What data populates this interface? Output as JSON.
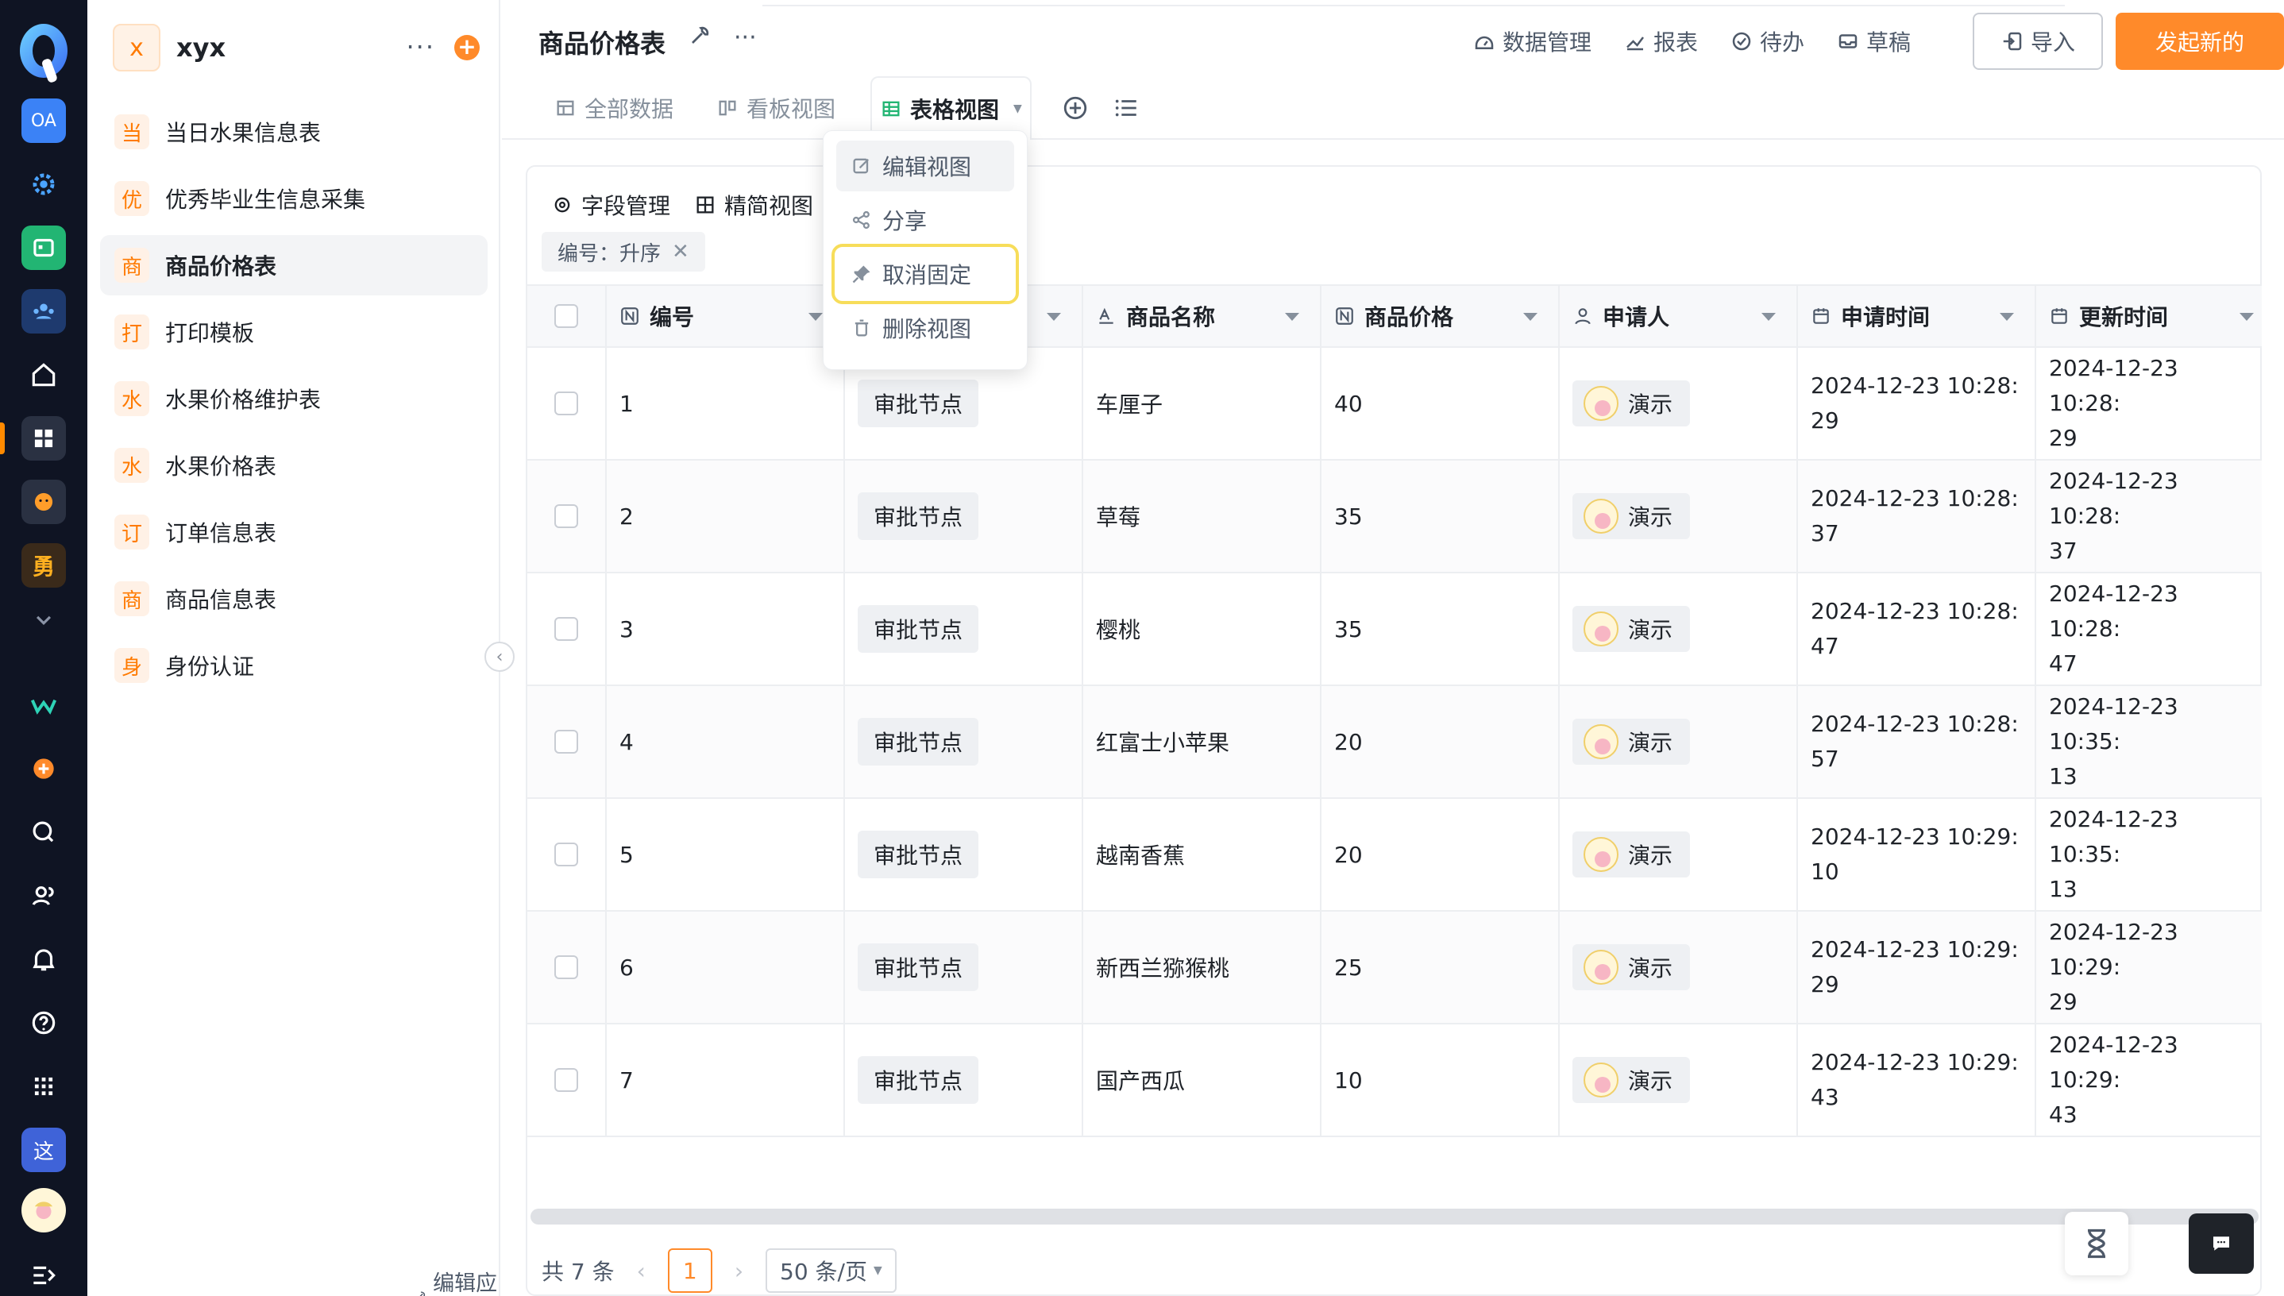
{
  "app": {
    "avatar_letter": "x",
    "name": "xyx",
    "edit_package": "编辑应用包"
  },
  "rail_colors": {
    "accent": "#ff8a00",
    "bg": "#0f1423"
  },
  "rail": {
    "oa_label": "OA",
    "yong_label": "勇",
    "zhe_label": "这"
  },
  "menu": [
    {
      "badge": "当",
      "label": "当日水果信息表"
    },
    {
      "badge": "优",
      "label": "优秀毕业生信息采集"
    },
    {
      "badge": "商",
      "label": "商品价格表"
    },
    {
      "badge": "打",
      "label": "打印模板"
    },
    {
      "badge": "水",
      "label": "水果价格维护表"
    },
    {
      "badge": "水",
      "label": "水果价格表"
    },
    {
      "badge": "订",
      "label": "订单信息表"
    },
    {
      "badge": "商",
      "label": "商品信息表"
    },
    {
      "badge": "身",
      "label": "身份认证"
    }
  ],
  "header": {
    "title": "商品价格表",
    "links": [
      "数据管理",
      "报表",
      "待办",
      "草稿"
    ],
    "import_label": "导入",
    "new_label": "发起新的"
  },
  "tabs": [
    "全部数据",
    "看板视图",
    "表格视图"
  ],
  "toolbar": {
    "fields": "字段管理",
    "simple_view": "精简视图"
  },
  "sort_chip": "编号：升序",
  "dropdown": [
    "编辑视图",
    "分享",
    "取消固定",
    "删除视图"
  ],
  "columns": [
    "编号",
    "",
    "商品名称",
    "商品价格",
    "申请人",
    "申请时间",
    "更新时间"
  ],
  "rows": [
    {
      "id": "1",
      "node": "审批节点",
      "name": "车厘子",
      "price": "40",
      "user": "演示",
      "apply": "2024-12-23 10:28:\n29",
      "update": "2024-12-23 10:28:\n29"
    },
    {
      "id": "2",
      "node": "审批节点",
      "name": "草莓",
      "price": "35",
      "user": "演示",
      "apply": "2024-12-23 10:28:\n37",
      "update": "2024-12-23 10:28:\n37"
    },
    {
      "id": "3",
      "node": "审批节点",
      "name": "樱桃",
      "price": "35",
      "user": "演示",
      "apply": "2024-12-23 10:28:\n47",
      "update": "2024-12-23 10:28:\n47"
    },
    {
      "id": "4",
      "node": "审批节点",
      "name": "红富士小苹果",
      "price": "20",
      "user": "演示",
      "apply": "2024-12-23 10:28:\n57",
      "update": "2024-12-23 10:35:\n13"
    },
    {
      "id": "5",
      "node": "审批节点",
      "name": "越南香蕉",
      "price": "20",
      "user": "演示",
      "apply": "2024-12-23 10:29:\n10",
      "update": "2024-12-23 10:35:\n13"
    },
    {
      "id": "6",
      "node": "审批节点",
      "name": "新西兰猕猴桃",
      "price": "25",
      "user": "演示",
      "apply": "2024-12-23 10:29:\n29",
      "update": "2024-12-23 10:29:\n29"
    },
    {
      "id": "7",
      "node": "审批节点",
      "name": "国产西瓜",
      "price": "10",
      "user": "演示",
      "apply": "2024-12-23 10:29:\n43",
      "update": "2024-12-23 10:29:\n43"
    }
  ],
  "footer": {
    "total": "共 7 条",
    "page": "1",
    "page_size": "50 条/页"
  }
}
